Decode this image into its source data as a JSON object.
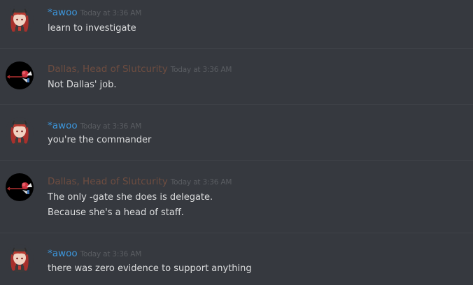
{
  "colors": {
    "background": "#36393f",
    "text": "#dcddde",
    "timestamp": "#5a5d62",
    "divider": "#3e4147"
  },
  "users": {
    "awoo": {
      "name": "*awoo",
      "color": "#3c97dd",
      "avatar_icon": "red-haired-character-avatar"
    },
    "dallas": {
      "name": "Dallas, Head of Slutcurity",
      "color": "#6e4d40",
      "avatar_icon": "black-circle-rose-avatar"
    }
  },
  "messages": [
    {
      "author": "awoo",
      "timestamp": "Today at 3:36 AM",
      "lines": [
        "learn to investigate"
      ]
    },
    {
      "author": "dallas",
      "timestamp": "Today at 3:36 AM",
      "lines": [
        "Not Dallas' job."
      ]
    },
    {
      "author": "awoo",
      "timestamp": "Today at 3:36 AM",
      "lines": [
        "you're the commander"
      ]
    },
    {
      "author": "dallas",
      "timestamp": "Today at 3:36 AM",
      "lines": [
        "The only -gate she does is delegate.",
        "Because she's a head of staff."
      ]
    },
    {
      "author": "awoo",
      "timestamp": "Today at 3:36 AM",
      "lines": [
        "there was zero evidence to support anything"
      ]
    }
  ]
}
